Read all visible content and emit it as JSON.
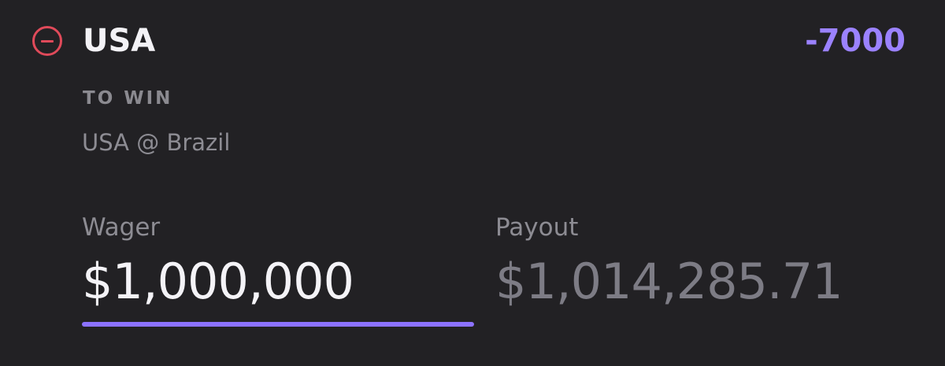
{
  "selection": {
    "team": "USA",
    "odds": "-7000",
    "market": "TO WIN",
    "matchup": "USA @ Brazil",
    "remove_icon": "minus-circle-icon"
  },
  "wager": {
    "label": "Wager",
    "value": "$1,000,000"
  },
  "payout": {
    "label": "Payout",
    "value": "$1,014,285.71"
  },
  "colors": {
    "background": "#222124",
    "accent": "#9b82ff",
    "remove": "#e04a5a",
    "muted_text": "#8d8c93",
    "primary_text": "#f3f2f6"
  }
}
